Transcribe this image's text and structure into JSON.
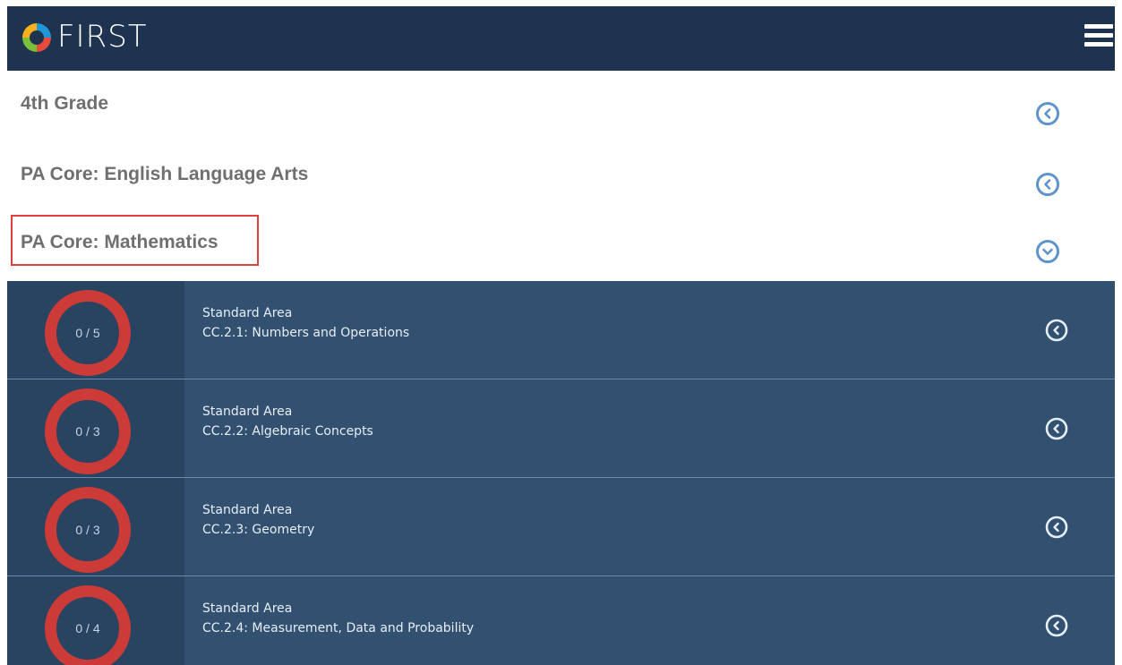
{
  "header": {
    "brand": "FIRST",
    "logo_icon": "first-logo-icon",
    "menu_icon": "hamburger-menu-icon"
  },
  "categories": [
    {
      "title": "4th Grade",
      "expanded": false
    },
    {
      "title": "PA Core: English Language Arts",
      "expanded": false
    },
    {
      "title": "PA Core: Mathematics",
      "expanded": true
    }
  ],
  "standards": [
    {
      "score": "0 / 5",
      "kind": "Standard Area",
      "name": "CC.2.1: Numbers and Operations"
    },
    {
      "score": "0 / 3",
      "kind": "Standard Area",
      "name": "CC.2.2: Algebraic Concepts"
    },
    {
      "score": "0 / 3",
      "kind": "Standard Area",
      "name": "CC.2.3: Geometry"
    },
    {
      "score": "0 / 4",
      "kind": "Standard Area",
      "name": "CC.2.4: Measurement, Data and Probability"
    }
  ],
  "colors": {
    "header_bg": "#1e3350",
    "panel_bg": "#32506f",
    "ring": "#cc3b37",
    "highlight": "#e04040",
    "icon_blue": "#5f93cc"
  }
}
